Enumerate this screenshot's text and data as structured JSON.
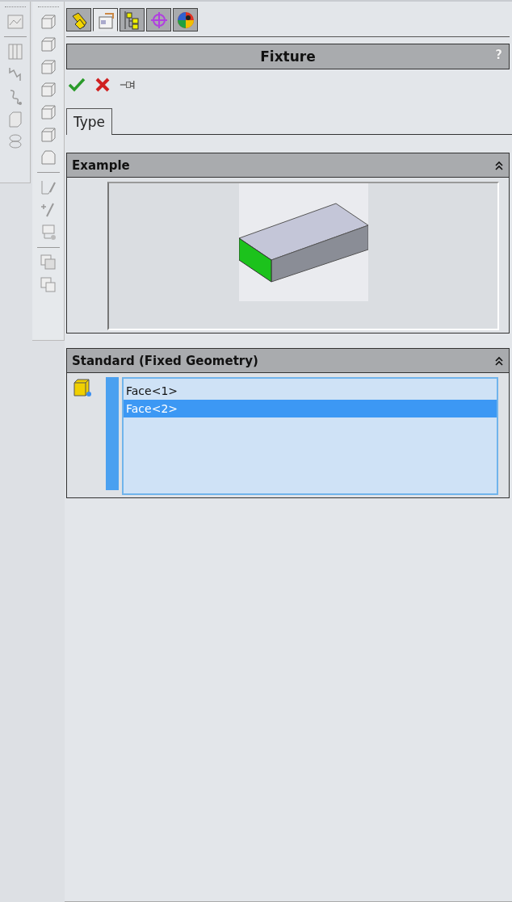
{
  "manager_tabs": [
    {
      "kind": "feature",
      "selected": false
    },
    {
      "kind": "property",
      "selected": true
    },
    {
      "kind": "config",
      "selected": false
    },
    {
      "kind": "dimxpert",
      "selected": false
    },
    {
      "kind": "display",
      "selected": false
    }
  ],
  "panel": {
    "title": "Fixture",
    "help": "?"
  },
  "tabs": [
    {
      "label": "Type",
      "selected": true
    }
  ],
  "sections": [
    {
      "kind": "example",
      "title": "Example",
      "expanded": true
    },
    {
      "kind": "selection",
      "title": "Standard (Fixed Geometry)",
      "expanded": true,
      "items": [
        {
          "label": "Face<1>",
          "selected": false
        },
        {
          "label": "Face<2>",
          "selected": true
        }
      ]
    }
  ]
}
